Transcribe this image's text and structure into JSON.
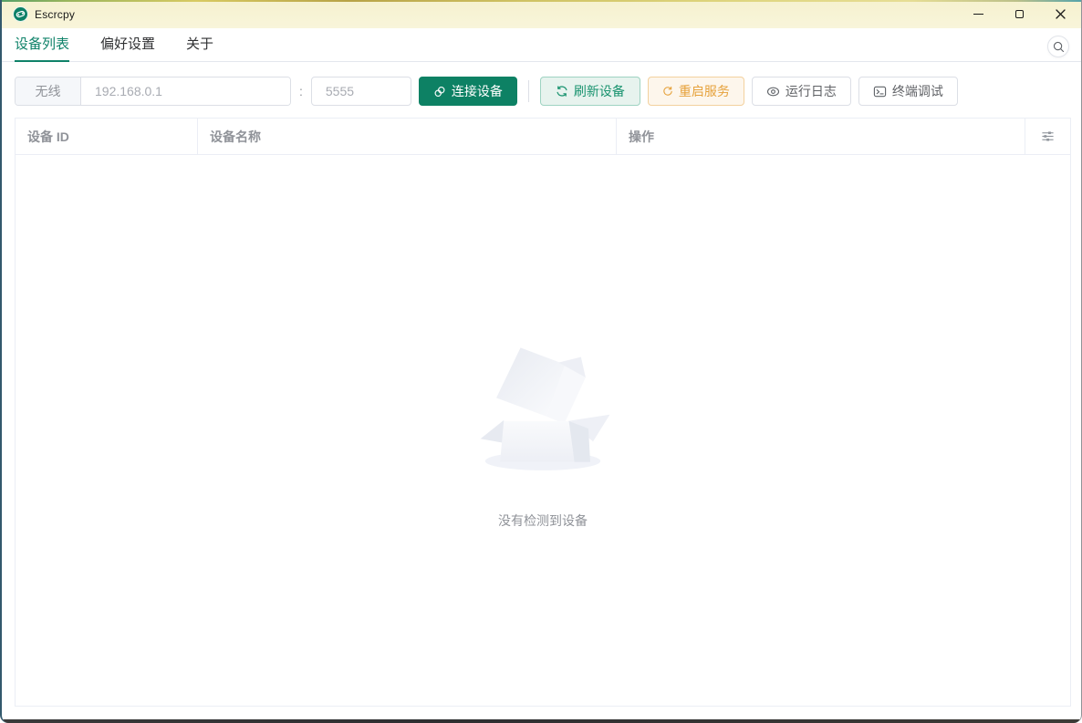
{
  "window": {
    "title": "Escrcpy"
  },
  "tabs": {
    "items": [
      {
        "label": "设备列表",
        "active": true
      },
      {
        "label": "偏好设置",
        "active": false
      },
      {
        "label": "关于",
        "active": false
      }
    ]
  },
  "toolbar": {
    "wireless_label": "无线",
    "ip_input": {
      "value": "",
      "placeholder": "192.168.0.1"
    },
    "separator": ":",
    "port_input": {
      "value": "",
      "placeholder": "5555"
    },
    "connect_button": "连接设备",
    "refresh_button": "刷新设备",
    "restart_button": "重启服务",
    "logs_button": "运行日志",
    "terminal_button": "终端调试"
  },
  "device_table": {
    "columns": [
      "设备 ID",
      "设备名称",
      "操作"
    ],
    "empty_text": "没有检测到设备"
  },
  "colors": {
    "primary_green": "#0d8164",
    "tab_active_green": "#0f8269",
    "warning_orange": "#e6a23c",
    "titlebar_bg": "#f8f5da",
    "header_text": "#909399",
    "border_light": "#ebeef5"
  }
}
